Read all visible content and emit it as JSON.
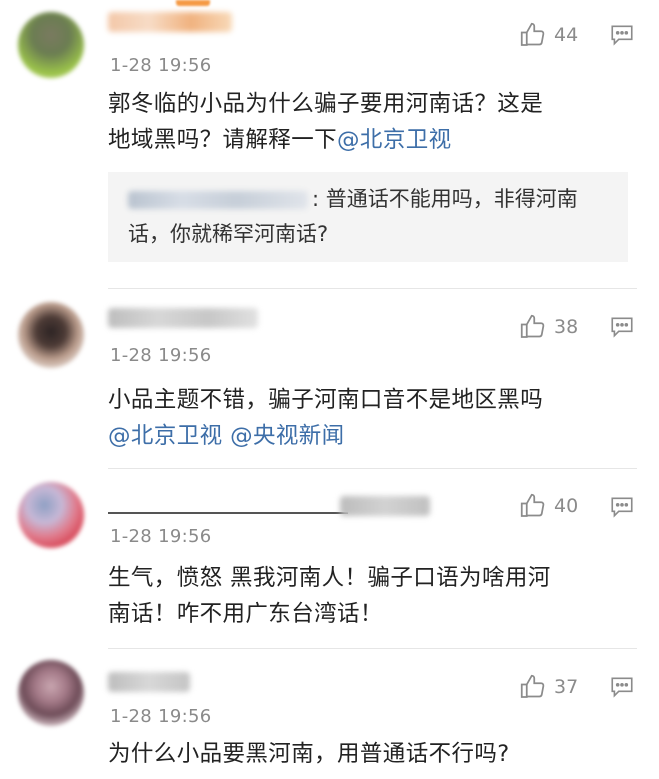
{
  "comments": [
    {
      "time": "1-28 19:56",
      "likes": "44",
      "text_lines": [
        "郭冬临的小品为什么骗子要用河南话？这是",
        "地域黑吗？请解释一下"
      ],
      "mention": "@北京卫视",
      "quote": {
        "text_line1": ": 普通话不能用吗，非得河南",
        "text_line2": "话，你就稀罕河南话?"
      }
    },
    {
      "time": "1-28 19:56",
      "likes": "38",
      "text_line1": "小品主题不错，骗子河南口音不是地区黑吗",
      "mentions": [
        "@北京卫视",
        "@央视新闻"
      ]
    },
    {
      "time": "1-28 19:56",
      "likes": "40",
      "text_lines": [
        "生气，愤怒 黑我河南人！骗子口语为啥用河",
        "南话！咋不用广东台湾话！"
      ]
    },
    {
      "time": "1-28 19:56",
      "likes": "37",
      "text_line1": "为什么小品要黑河南，用普通话不行吗?"
    }
  ],
  "icons": {
    "like": "thumbs-up-icon",
    "reply": "comment-icon"
  },
  "colors": {
    "link": "#3d6ea8",
    "time": "#8a8a8a",
    "quote_bg": "#f4f4f4"
  }
}
